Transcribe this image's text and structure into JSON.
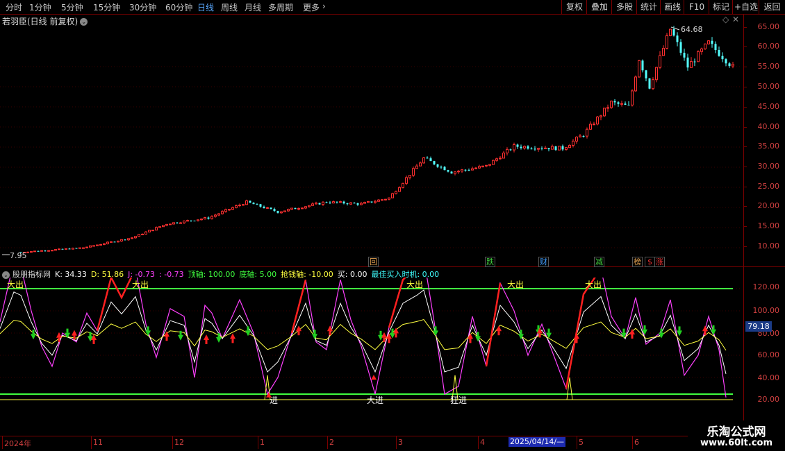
{
  "toolbar": {
    "periods": [
      "分时",
      "1分钟",
      "5分钟",
      "15分钟",
      "30分钟",
      "60分钟",
      "日线",
      "周线",
      "月线",
      "多周期",
      "更多"
    ],
    "active_period": "日线",
    "tools": [
      "复权",
      "叠加",
      "多股",
      "统计",
      "画线",
      "F10",
      "标记",
      "+自选",
      "返回"
    ]
  },
  "main_chart": {
    "stock_title": "若羽臣(日线 前复权)",
    "high_label": "64.68",
    "low_label": "7.95",
    "price_axis": [
      "65.00",
      "60.00",
      "55.00",
      "50.00",
      "45.00",
      "40.00",
      "35.00",
      "30.00",
      "25.00",
      "20.00",
      "15.00",
      "10.00"
    ],
    "event_badges": [
      {
        "text": "回",
        "color": "#e0a050"
      },
      {
        "text": "跌",
        "color": "#40d040"
      },
      {
        "text": "财",
        "color": "#40a0ff"
      },
      {
        "text": "减",
        "color": "#40d040"
      },
      {
        "text": "榜",
        "color": "#e0a050"
      },
      {
        "text": "$",
        "color": "#e03030"
      },
      {
        "text": "涨",
        "color": "#e03030"
      }
    ]
  },
  "indicator": {
    "name": "股朋指标网",
    "k_label": "K: 34.33",
    "d_label": "D: 51.86",
    "j_label": "J: -0.73",
    "extra_label": ": -0.73",
    "top_axis": "顶轴: 100.00",
    "bottom_axis": "底轴: 5.00",
    "grab_axis": "抢钱轴: -10.00",
    "buy": "买: 0.00",
    "best_buy": "最佳买入时机: 0.00",
    "axis": [
      "120.00",
      "100.00",
      "80.00",
      "60.00",
      "40.00",
      "20.00"
    ],
    "current_value": "79.18",
    "sell_label": "大出",
    "sell_labels": [
      "大出",
      "大出",
      "大出",
      "大出",
      "大出"
    ],
    "buy_labels": [
      "进",
      "大进",
      "狂进"
    ],
    "colors": {
      "k": "#ffffff",
      "d": "#ffff40",
      "j": "#ff40ff",
      "up": "#ff2020",
      "top_line": "#40ff40"
    }
  },
  "date_axis": {
    "labels": [
      "2024年",
      "11",
      "12",
      "1",
      "2",
      "3",
      "4",
      "5",
      "6"
    ],
    "cursor_date": "2025/04/14/—"
  },
  "watermark": {
    "name": "乐淘公式网",
    "url": "www.60lt.com"
  }
}
